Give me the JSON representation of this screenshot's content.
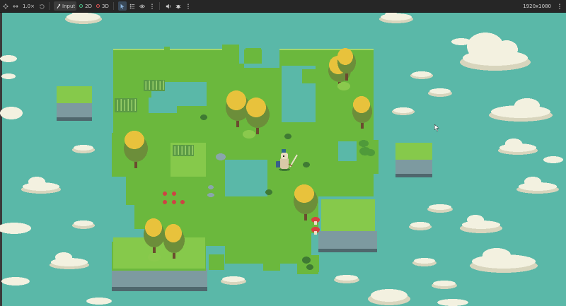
{
  "toolbar": {
    "zoom_label": "1.0×",
    "input_label": "Input",
    "mode_2d_label": "2D",
    "mode_3d_label": "3D",
    "resolution_label": "1920x1080",
    "colors": {
      "mode_2d": "#4cc38a",
      "mode_3d": "#e05555"
    }
  },
  "scene": {
    "colors": {
      "water": "#5ab8a8",
      "grass": "#6bb83d",
      "grass_light": "#86c94b",
      "grass_edge": "#a6d86b",
      "cliff": "#7d9aa0",
      "cliff_dark": "#4f676d",
      "tree_yellow": "#e8c23c",
      "tree_green": "#6c8e3a",
      "trunk": "#6b4b2f",
      "cloud": "#f3f1e0",
      "cloud_shadow": "#d8d5bd"
    }
  }
}
